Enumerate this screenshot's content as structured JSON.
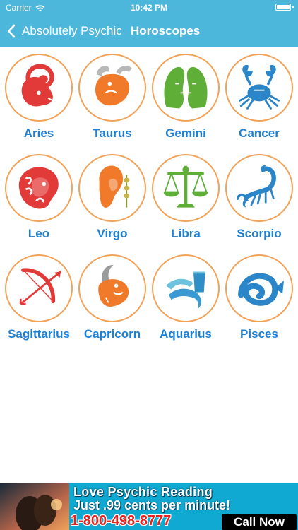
{
  "status_bar": {
    "carrier": "Carrier",
    "time": "10:42 PM",
    "battery_level": 1.0
  },
  "nav": {
    "back_label": "Absolutely Psychic",
    "title": "Horoscopes",
    "back_icon": "chevron-left-icon"
  },
  "colors": {
    "nav_background": "#4db6db",
    "sign_label": "#1d7fd6",
    "circle_border": "#f0a35a",
    "fire": "#e23a39",
    "earth": "#f07a2a",
    "air": "#5fae38",
    "water": "#2a86c8"
  },
  "signs": [
    {
      "name": "Aries",
      "icon": "aries-ram-icon"
    },
    {
      "name": "Taurus",
      "icon": "taurus-bull-icon"
    },
    {
      "name": "Gemini",
      "icon": "gemini-twins-icon"
    },
    {
      "name": "Cancer",
      "icon": "cancer-crab-icon"
    },
    {
      "name": "Leo",
      "icon": "leo-lion-icon"
    },
    {
      "name": "Virgo",
      "icon": "virgo-maiden-icon"
    },
    {
      "name": "Libra",
      "icon": "libra-scales-icon"
    },
    {
      "name": "Scorpio",
      "icon": "scorpio-scorpion-icon"
    },
    {
      "name": "Sagittarius",
      "icon": "sagittarius-bow-icon"
    },
    {
      "name": "Capricorn",
      "icon": "capricorn-goat-icon"
    },
    {
      "name": "Aquarius",
      "icon": "aquarius-water-icon"
    },
    {
      "name": "Pisces",
      "icon": "pisces-fish-icon"
    }
  ],
  "ad": {
    "line1": "Love Psychic Reading",
    "line2": "Just .99 cents per minute!",
    "phone": "1-800-498-8777",
    "cta": "Call Now"
  }
}
